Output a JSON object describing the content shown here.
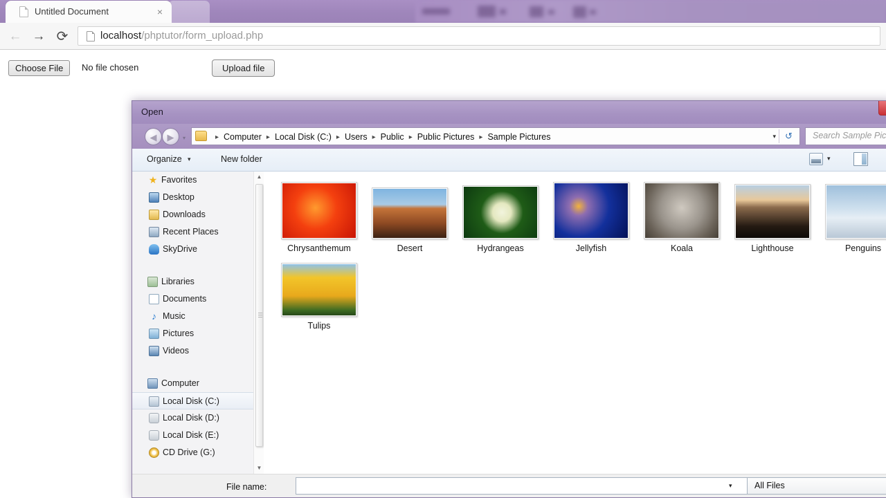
{
  "browser": {
    "tab": {
      "title": "Untitled Document",
      "close_label": "×",
      "favicon": "document-icon"
    },
    "nav": {
      "back": "←",
      "forward": "→",
      "reload": "⟳"
    },
    "omnibox": {
      "host": "localhost",
      "path": "/phptutor/form_upload.php",
      "page_icon": "page-icon"
    }
  },
  "page": {
    "choose_file_label": "Choose File",
    "file_status": "No file chosen",
    "upload_label": "Upload file"
  },
  "dialog": {
    "title": "Open",
    "close_label": "",
    "nav": {
      "back": "◀",
      "forward": "▶",
      "recent_caret": "▾"
    },
    "breadcrumb": {
      "items": [
        "Computer",
        "Local Disk (C:)",
        "Users",
        "Public",
        "Public Pictures",
        "Sample Pictures"
      ],
      "separator": "▸",
      "caret": "▾",
      "refresh": "↺"
    },
    "search": {
      "placeholder": "Search Sample Pictures"
    },
    "toolbar": {
      "organize": "Organize",
      "organize_caret": "▾",
      "new_folder": "New folder",
      "views_caret": "▾",
      "views_icon": "views-icon",
      "preview_icon": "preview-pane-icon"
    },
    "sidebar": {
      "groups": [
        {
          "name": "Favorites",
          "icon": "star-icon",
          "icon_class": "ico-star",
          "items": [
            {
              "label": "Desktop",
              "icon": "desktop-icon",
              "icon_class": "ico-desktop",
              "selected": false
            },
            {
              "label": "Downloads",
              "icon": "downloads-icon",
              "icon_class": "ico-down",
              "selected": false
            },
            {
              "label": "Recent Places",
              "icon": "recent-places-icon",
              "icon_class": "ico-recent",
              "selected": false
            },
            {
              "label": "SkyDrive",
              "icon": "skydrive-icon",
              "icon_class": "ico-sky",
              "selected": false
            }
          ]
        },
        {
          "name": "Libraries",
          "icon": "libraries-icon",
          "icon_class": "ico-lib",
          "items": [
            {
              "label": "Documents",
              "icon": "documents-icon",
              "icon_class": "ico-doc",
              "selected": false
            },
            {
              "label": "Music",
              "icon": "music-icon",
              "icon_class": "ico-music",
              "selected": false
            },
            {
              "label": "Pictures",
              "icon": "pictures-icon",
              "icon_class": "ico-pic",
              "selected": false
            },
            {
              "label": "Videos",
              "icon": "videos-icon",
              "icon_class": "ico-vid",
              "selected": false
            }
          ]
        },
        {
          "name": "Computer",
          "icon": "computer-icon",
          "icon_class": "ico-computer",
          "items": [
            {
              "label": "Local Disk (C:)",
              "icon": "hard-disk-icon",
              "icon_class": "ico-diskc",
              "selected": true
            },
            {
              "label": "Local Disk (D:)",
              "icon": "hard-disk-icon",
              "icon_class": "ico-disk",
              "selected": false
            },
            {
              "label": "Local Disk (E:)",
              "icon": "hard-disk-icon",
              "icon_class": "ico-disk",
              "selected": false
            },
            {
              "label": "CD Drive (G:)",
              "icon": "cd-drive-icon",
              "icon_class": "ico-cd",
              "selected": false
            }
          ]
        }
      ],
      "scroll": {
        "up_arrow": "▲",
        "down_arrow": "▼"
      }
    },
    "files": [
      {
        "name": "Chrysanthemum",
        "art": "art-chrys",
        "w": 108,
        "h": 81
      },
      {
        "name": "Desert",
        "art": "art-desert",
        "w": 108,
        "h": 81
      },
      {
        "name": "Hydrangeas",
        "art": "art-hydr",
        "w": 108,
        "h": 81
      },
      {
        "name": "Jellyfish",
        "art": "art-jelly",
        "w": 108,
        "h": 81
      },
      {
        "name": "Koala",
        "art": "art-koala",
        "w": 108,
        "h": 81
      },
      {
        "name": "Lighthouse",
        "art": "art-light",
        "w": 108,
        "h": 81
      },
      {
        "name": "Penguins",
        "art": "art-peng",
        "w": 108,
        "h": 81
      },
      {
        "name": "Tulips",
        "art": "art-tulip",
        "w": 108,
        "h": 81
      }
    ],
    "bottom": {
      "file_name_label": "File name:",
      "file_name_value": "",
      "file_name_caret": "▾",
      "filter_value": "All Files"
    }
  },
  "colors": {
    "accent_purple": "#a692c2",
    "titlebar_purple": "#b5a3cd",
    "toolbar_blue": "#e6eef7",
    "close_red": "#c93036"
  }
}
